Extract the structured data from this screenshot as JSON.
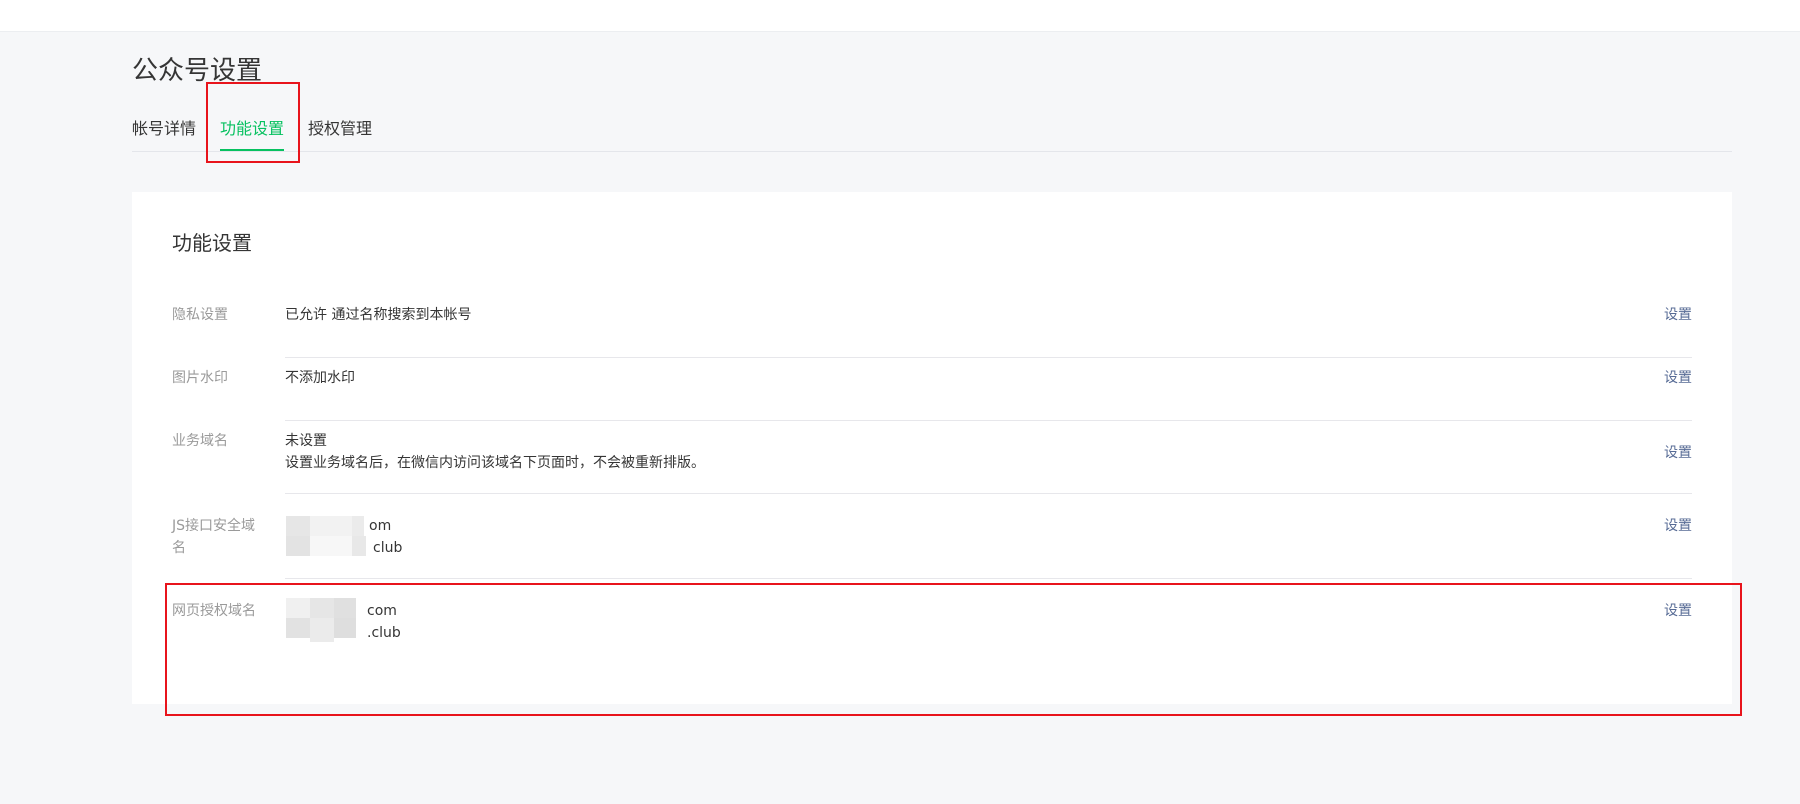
{
  "page": {
    "title": "公众号设置"
  },
  "tabs": [
    {
      "label": "帐号详情",
      "active": false
    },
    {
      "label": "功能设置",
      "active": true
    },
    {
      "label": "授权管理",
      "active": false
    }
  ],
  "card": {
    "title": "功能设置",
    "rows": [
      {
        "label": "隐私设置",
        "value": "已允许 通过名称搜索到本帐号",
        "action": "设置"
      },
      {
        "label": "图片水印",
        "value": "不添加水印",
        "action": "设置"
      },
      {
        "label": "业务域名",
        "value": "未设置",
        "note": "设置业务域名后，在微信内访问该域名下页面时，不会被重新排版。",
        "action": "设置"
      },
      {
        "label": "JS接口安全域名",
        "domains": [
          "om",
          "club"
        ],
        "action": "设置"
      },
      {
        "label": "网页授权域名",
        "domains": [
          "com",
          ".club"
        ],
        "action": "设置"
      }
    ]
  },
  "colors": {
    "accent_green": "#07c160",
    "link_blue": "#576b95",
    "annotation_red": "#e8141c",
    "page_background": "#f6f7f9"
  }
}
